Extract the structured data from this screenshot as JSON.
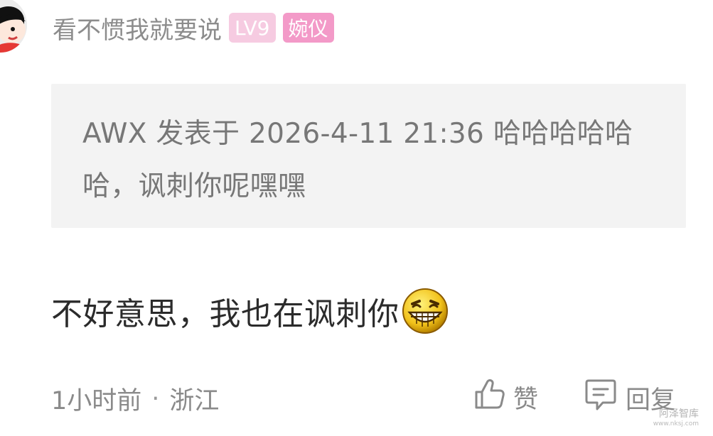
{
  "user": {
    "name": "看不惯我就要说",
    "level": "LV9",
    "title": "婉仪",
    "avatar_icon": "cartoon-avatar-icon"
  },
  "quote": {
    "text": "AWX 发表于 2026-4-11 21:36 哈哈哈哈哈哈，讽刺你呢嘿嘿"
  },
  "comment": {
    "text": "不好意思，我也在讽刺你",
    "emoji_icon": "laughing-emoji-icon"
  },
  "footer": {
    "time": "1小时前",
    "separator": "·",
    "location": "浙江",
    "like_label": "赞",
    "reply_label": "回复"
  },
  "watermark": {
    "text": "阿泽智库",
    "sub": "www.nksj.com"
  },
  "colors": {
    "level_badge": "#f6cbe1",
    "title_badge": "#f39ac8",
    "quote_bg": "#f3f3f3",
    "muted_text": "#8a8a8a"
  }
}
